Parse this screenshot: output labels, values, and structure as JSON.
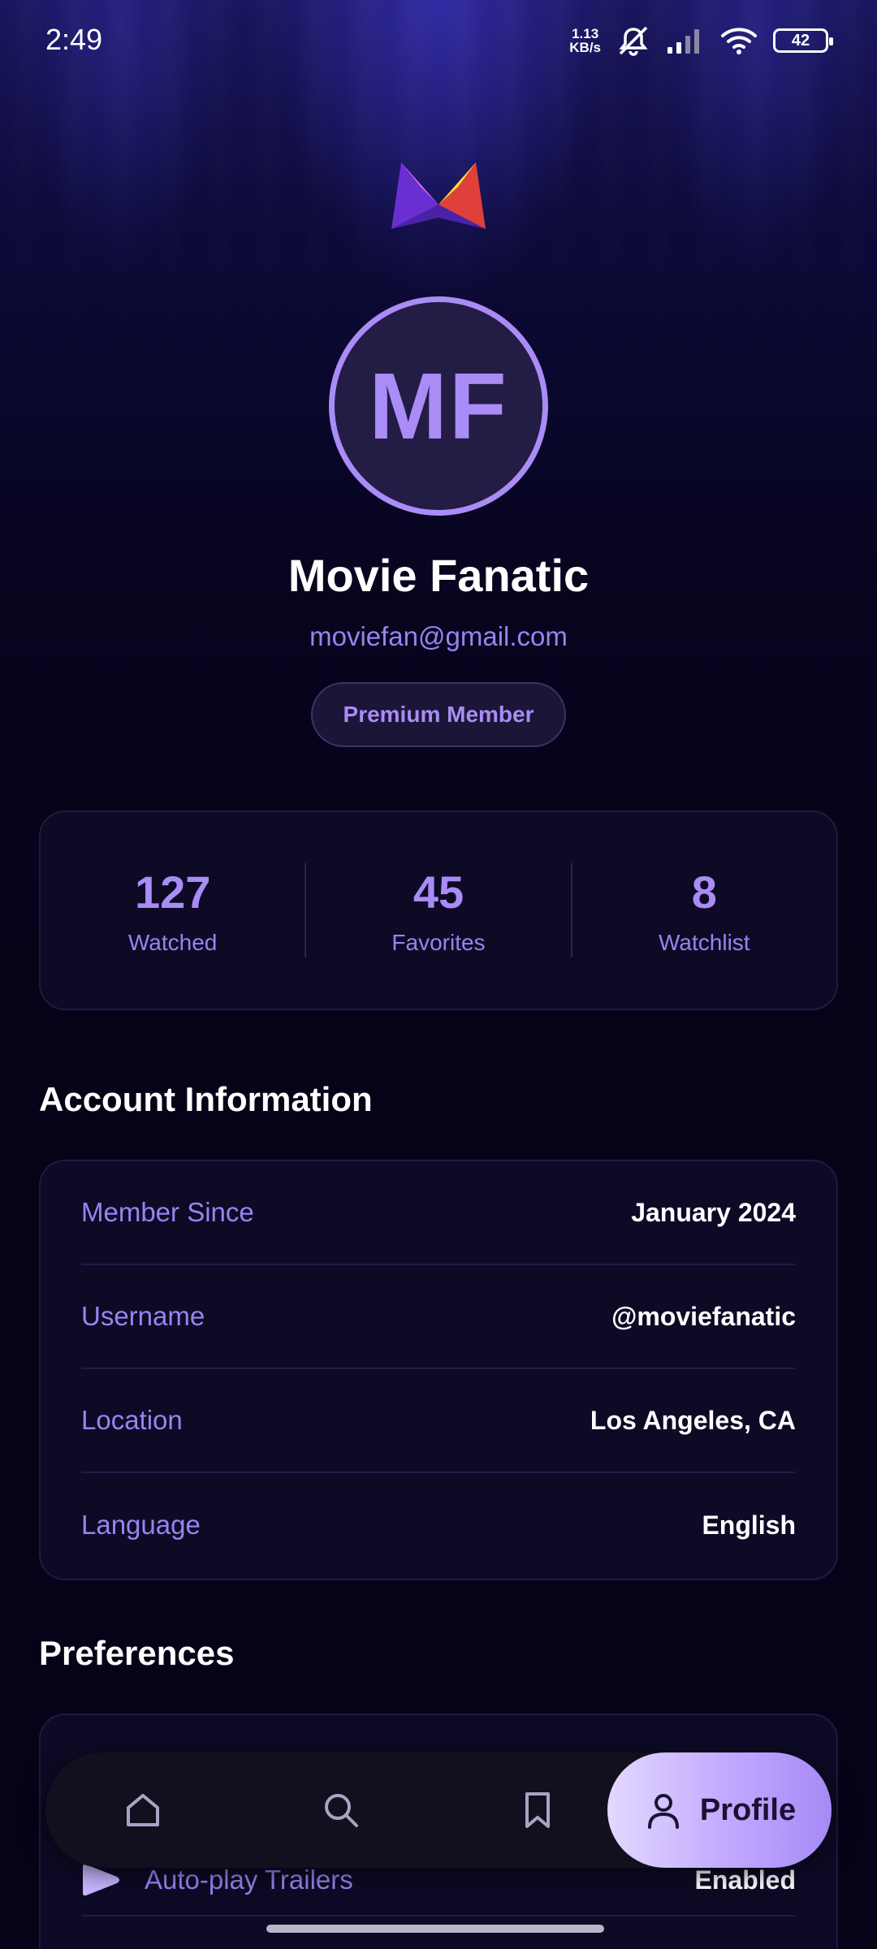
{
  "status_bar": {
    "time": "2:49",
    "net_speed_value": "1.13",
    "net_speed_unit": "KB/s",
    "battery": "42",
    "icons": [
      "mute-icon",
      "signal-icon",
      "wifi-icon",
      "battery-icon"
    ]
  },
  "profile": {
    "initials": "MF",
    "name": "Movie Fanatic",
    "email": "moviefan@gmail.com",
    "badge": "Premium Member"
  },
  "stats": [
    {
      "value": "127",
      "label": "Watched"
    },
    {
      "value": "45",
      "label": "Favorites"
    },
    {
      "value": "8",
      "label": "Watchlist"
    }
  ],
  "account": {
    "title": "Account Information",
    "rows": [
      {
        "label": "Member Since",
        "value": "January 2024"
      },
      {
        "label": "Username",
        "value": "@moviefanatic"
      },
      {
        "label": "Location",
        "value": "Los Angeles, CA"
      },
      {
        "label": "Language",
        "value": "English"
      }
    ]
  },
  "preferences": {
    "title": "Preferences",
    "rows": [
      {
        "label": "Auto-play Trailers",
        "value": "Enabled",
        "icon": "play-icon"
      }
    ]
  },
  "bottom_nav": {
    "items": [
      {
        "icon": "home-icon"
      },
      {
        "icon": "search-icon"
      },
      {
        "icon": "bookmark-icon"
      },
      {
        "icon": "user-icon",
        "label": "Profile",
        "active": true
      }
    ]
  },
  "colors": {
    "accent": "#a98cf5",
    "accent_text": "#9b82ef",
    "background": "#050318",
    "card": "#0d0a26",
    "active_nav": "#c0a8ff"
  }
}
